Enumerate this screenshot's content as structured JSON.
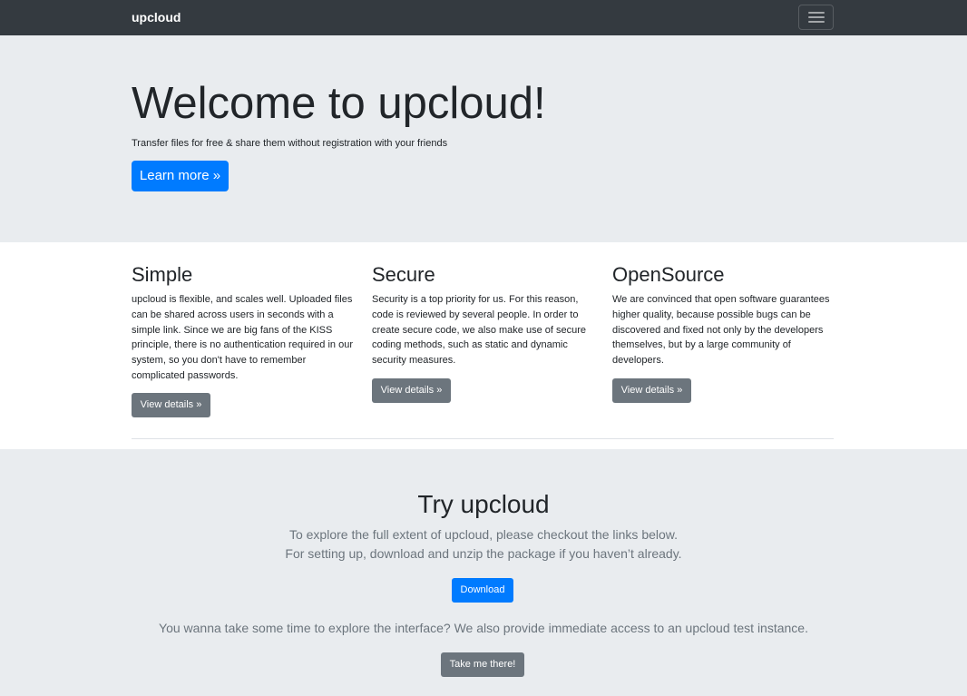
{
  "navbar": {
    "brand": "upcloud",
    "toggle_icon": "hamburger-menu-icon"
  },
  "hero": {
    "title": "Welcome to upcloud!",
    "subtitle": "Transfer files for free & share them without registration with your friends",
    "button_label": "Learn more »"
  },
  "features": [
    {
      "title": "Simple",
      "text": "upcloud is flexible, and scales well. Uploaded files can be shared across users in seconds with a simple link. Since we are big fans of the KISS principle, there is no authentication required in our system, so you don't have to remember complicated passwords.",
      "button_label": "View details »"
    },
    {
      "title": "Secure",
      "text": "Security is a top priority for us. For this reason, code is reviewed by several people. In order to create secure code, we also make use of secure coding methods, such as static and dynamic security measures.",
      "button_label": "View details »"
    },
    {
      "title": "OpenSource",
      "text": "We are convinced that open software guarantees higher quality, because possible bugs can be discovered and fixed not only by the developers themselves, but by a large community of developers.",
      "button_label": "View details »"
    }
  ],
  "try": {
    "title": "Try upcloud",
    "line1": "To explore the full extent of upcloud, please checkout the links below.",
    "line2": "For setting up, download and unzip the package if you haven’t already.",
    "download_label": "Download",
    "line3": "You wanna take some time to explore the interface? We also provide immediate access to an upcloud test instance.",
    "take_label": "Take me there!"
  },
  "colors": {
    "navbar": "#343a40",
    "jumbotron": "#e9ecef",
    "primary": "#007bff",
    "secondary": "#6c757d"
  }
}
